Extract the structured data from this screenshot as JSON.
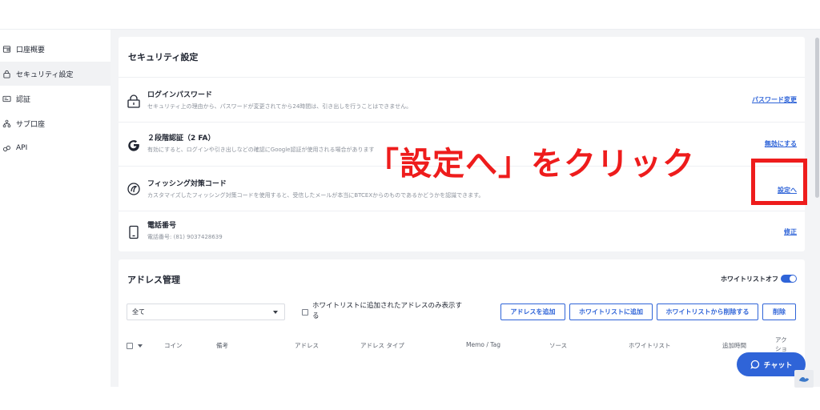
{
  "sidebar": {
    "items": [
      {
        "label": "口座概要",
        "icon": "account-icon"
      },
      {
        "label": "セキュリティ設定",
        "icon": "lock-icon"
      },
      {
        "label": "認証",
        "icon": "id-card-icon"
      },
      {
        "label": "サブ口座",
        "icon": "sub-account-icon"
      },
      {
        "label": "API",
        "icon": "link-icon"
      }
    ]
  },
  "security": {
    "title": "セキュリティ設定",
    "rows": [
      {
        "title": "ログインパスワード",
        "desc": "セキュリティ上の理由から、パスワードが変更されてから24時間は、引き出しを行うことはできません。",
        "action": "パスワード変更",
        "icon": "lock-icon"
      },
      {
        "title": "２段階認証（2 FA）",
        "desc": "有効にすると、ログインや引き出しなどの確認にGoogle認証が使用される場合があります",
        "action": "無効にする",
        "icon": "google-icon"
      },
      {
        "title": "フィッシング対策コード",
        "desc": "カスタマイズしたフィッシング対策コードを使用すると、受信したメールが本当にBTCEXからのものであるかどうかを認識できます。",
        "action": "設定へ",
        "icon": "anti-phishing-icon"
      },
      {
        "title": "電話番号",
        "desc": "電話番号: (81) 9037428639",
        "action": "修正",
        "icon": "phone-icon"
      }
    ]
  },
  "annotation": {
    "text": "「設定へ」をクリック",
    "color": "#ee1c1c"
  },
  "address": {
    "title": "アドレス管理",
    "whitelist_toggle_label": "ホワイトリストオフ",
    "filter_value": "全て",
    "only_whitelist_label": "ホワイトリストに追加されたアドレスのみ表示する",
    "buttons": [
      "アドレスを追加",
      "ホワイトリストに追加",
      "ホワイトリストから削除する",
      "削除"
    ],
    "columns": [
      "コイン",
      "備考",
      "アドレス",
      "アドレス タイプ",
      "Memo / Tag",
      "ソース",
      "ホワイトリスト",
      "追加時間",
      "アクション"
    ]
  },
  "chat": {
    "label": "チャット"
  },
  "colors": {
    "accent": "#2f64d8",
    "annotation": "#ee1c1c"
  }
}
